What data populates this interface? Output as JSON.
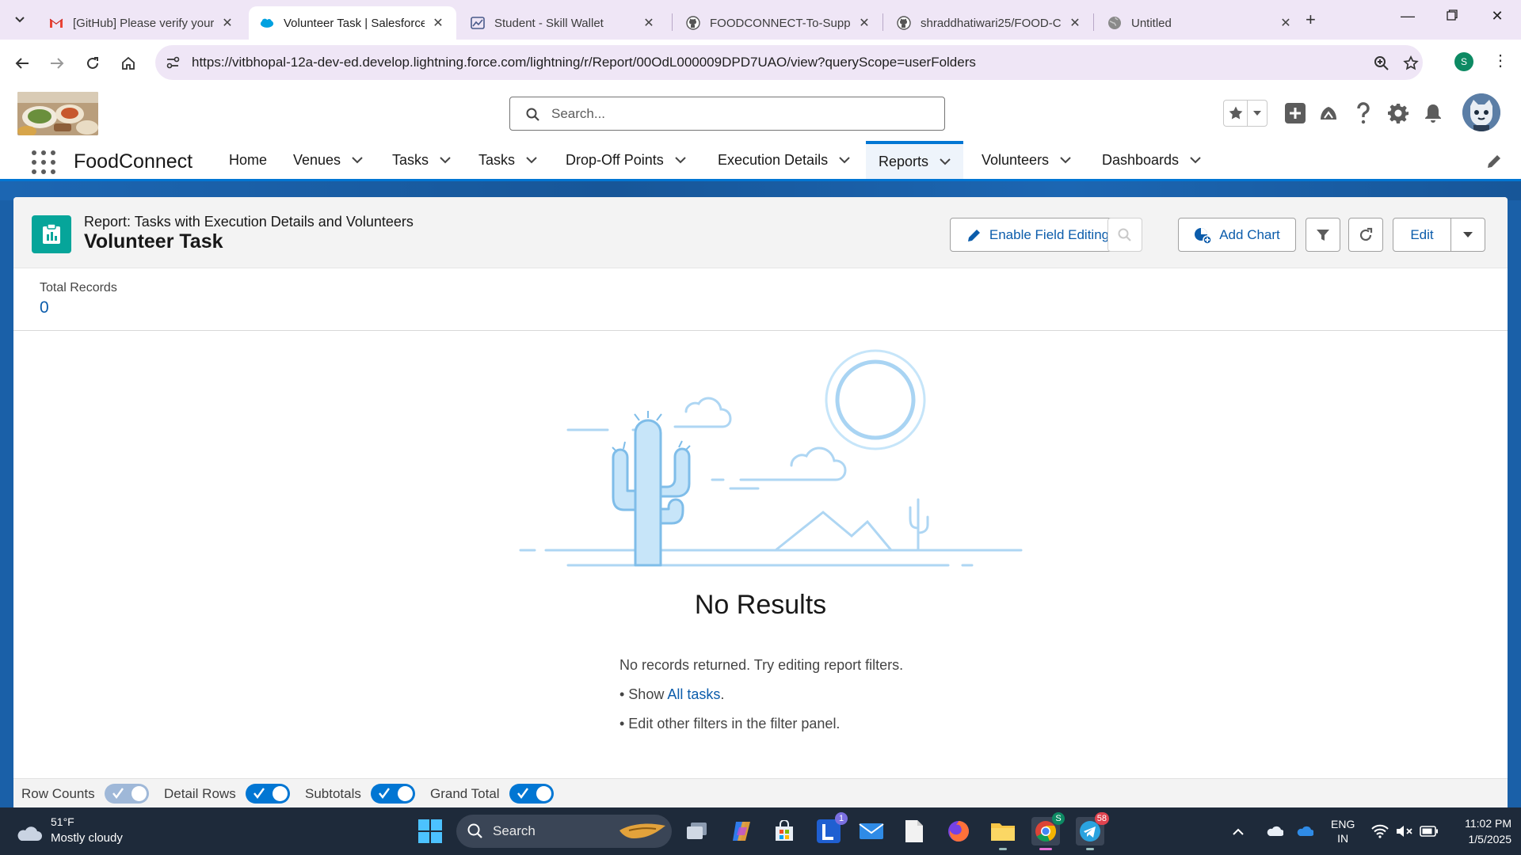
{
  "browser": {
    "tabs": [
      {
        "title": "[GitHub] Please verify your",
        "icon": "gmail-icon"
      },
      {
        "title": "Volunteer Task | Salesforce",
        "icon": "salesforce-icon",
        "active": true
      },
      {
        "title": "Student - Skill Wallet",
        "icon": "skillwallet-icon"
      },
      {
        "title": "FOODCONNECT-To-Supply",
        "icon": "github-icon"
      },
      {
        "title": "shraddhatiwari25/FOOD-C",
        "icon": "github-icon"
      },
      {
        "title": "Untitled",
        "icon": "globe-icon"
      }
    ],
    "url": "https://vitbhopal-12a-dev-ed.develop.lightning.force.com/lightning/r/Report/00OdL000009DPD7UAO/view?queryScope=userFolders",
    "profile_initial": "S"
  },
  "sf": {
    "search_placeholder": "Search...",
    "app_name": "FoodConnect",
    "nav": [
      {
        "label": "Home",
        "dropdown": false
      },
      {
        "label": "Venues",
        "dropdown": true
      },
      {
        "label": "Tasks",
        "dropdown": true
      },
      {
        "label": "Tasks",
        "dropdown": true
      },
      {
        "label": "Drop-Off Points",
        "dropdown": true
      },
      {
        "label": "Execution Details",
        "dropdown": true
      },
      {
        "label": "Reports",
        "dropdown": true,
        "active": true
      },
      {
        "label": "Volunteers",
        "dropdown": true
      },
      {
        "label": "Dashboards",
        "dropdown": true
      }
    ]
  },
  "report": {
    "type_label": "Report: Tasks with Execution Details and Volunteers",
    "name": "Volunteer Task",
    "buttons": {
      "enable_field_editing": "Enable Field Editing",
      "add_chart": "Add Chart",
      "edit": "Edit"
    },
    "total_records_label": "Total Records",
    "total_records_value": "0",
    "empty": {
      "title": "No Results",
      "message": "No records returned. Try editing report filters.",
      "show_prefix": "• Show ",
      "show_link": "All tasks",
      "show_suffix": ".",
      "edit_filters": "• Edit other filters in the filter panel."
    },
    "toggles": [
      {
        "label": "Row Counts",
        "on": false
      },
      {
        "label": "Detail Rows",
        "on": true
      },
      {
        "label": "Subtotals",
        "on": true
      },
      {
        "label": "Grand Total",
        "on": true
      }
    ]
  },
  "taskbar": {
    "weather_temp": "51°F",
    "weather_desc": "Mostly cloudy",
    "search_label": "Search",
    "lang_top": "ENG",
    "lang_bottom": "IN",
    "time": "11:02 PM",
    "date": "1/5/2025",
    "badges": {
      "l_app": "1",
      "chrome": "S",
      "telegram": "58"
    }
  },
  "colors": {
    "brand": "#0176d3",
    "link": "#0b5cab",
    "report_icon": "#06a59a",
    "chrome_tabstrip": "#efe6f6"
  }
}
